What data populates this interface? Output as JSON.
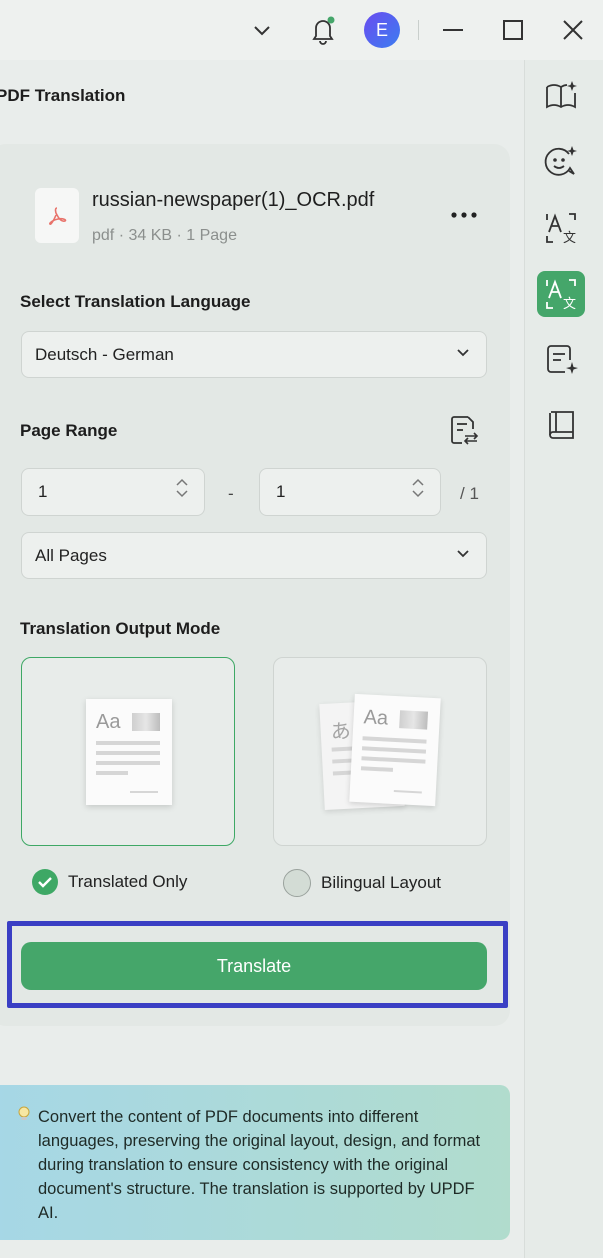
{
  "titlebar": {
    "avatar_letter": "E"
  },
  "panel": {
    "title": "PDF Translation"
  },
  "file": {
    "name": "russian-newspaper(1)_OCR.pdf",
    "meta": "pdf · 34 KB · 1 Page"
  },
  "language": {
    "label": "Select Translation Language",
    "selected": "Deutsch - German"
  },
  "page_range": {
    "label": "Page Range",
    "from": "1",
    "separator": "-",
    "to": "1",
    "total": "/ 1",
    "scope_selected": "All Pages"
  },
  "output_mode": {
    "label": "Translation Output Mode",
    "options": [
      {
        "label": "Translated Only",
        "selected": true
      },
      {
        "label": "Bilingual Layout",
        "selected": false
      }
    ],
    "thumb_text_a": "Aa",
    "thumb_text_b": "あ"
  },
  "translate_button": "Translate",
  "info": {
    "text": "Convert the content of PDF documents into different languages, preserving the original layout, design, and format during translation to ensure consistency with the original document's structure. The translation is supported by UPDF AI."
  },
  "colors": {
    "accent": "#45a66a",
    "highlight": "#3a3fc4"
  },
  "sidebar_icons": [
    "reader-icon",
    "ai-chat-icon",
    "translate-icon",
    "pdf-translate-icon",
    "summarize-icon",
    "book-icon"
  ]
}
